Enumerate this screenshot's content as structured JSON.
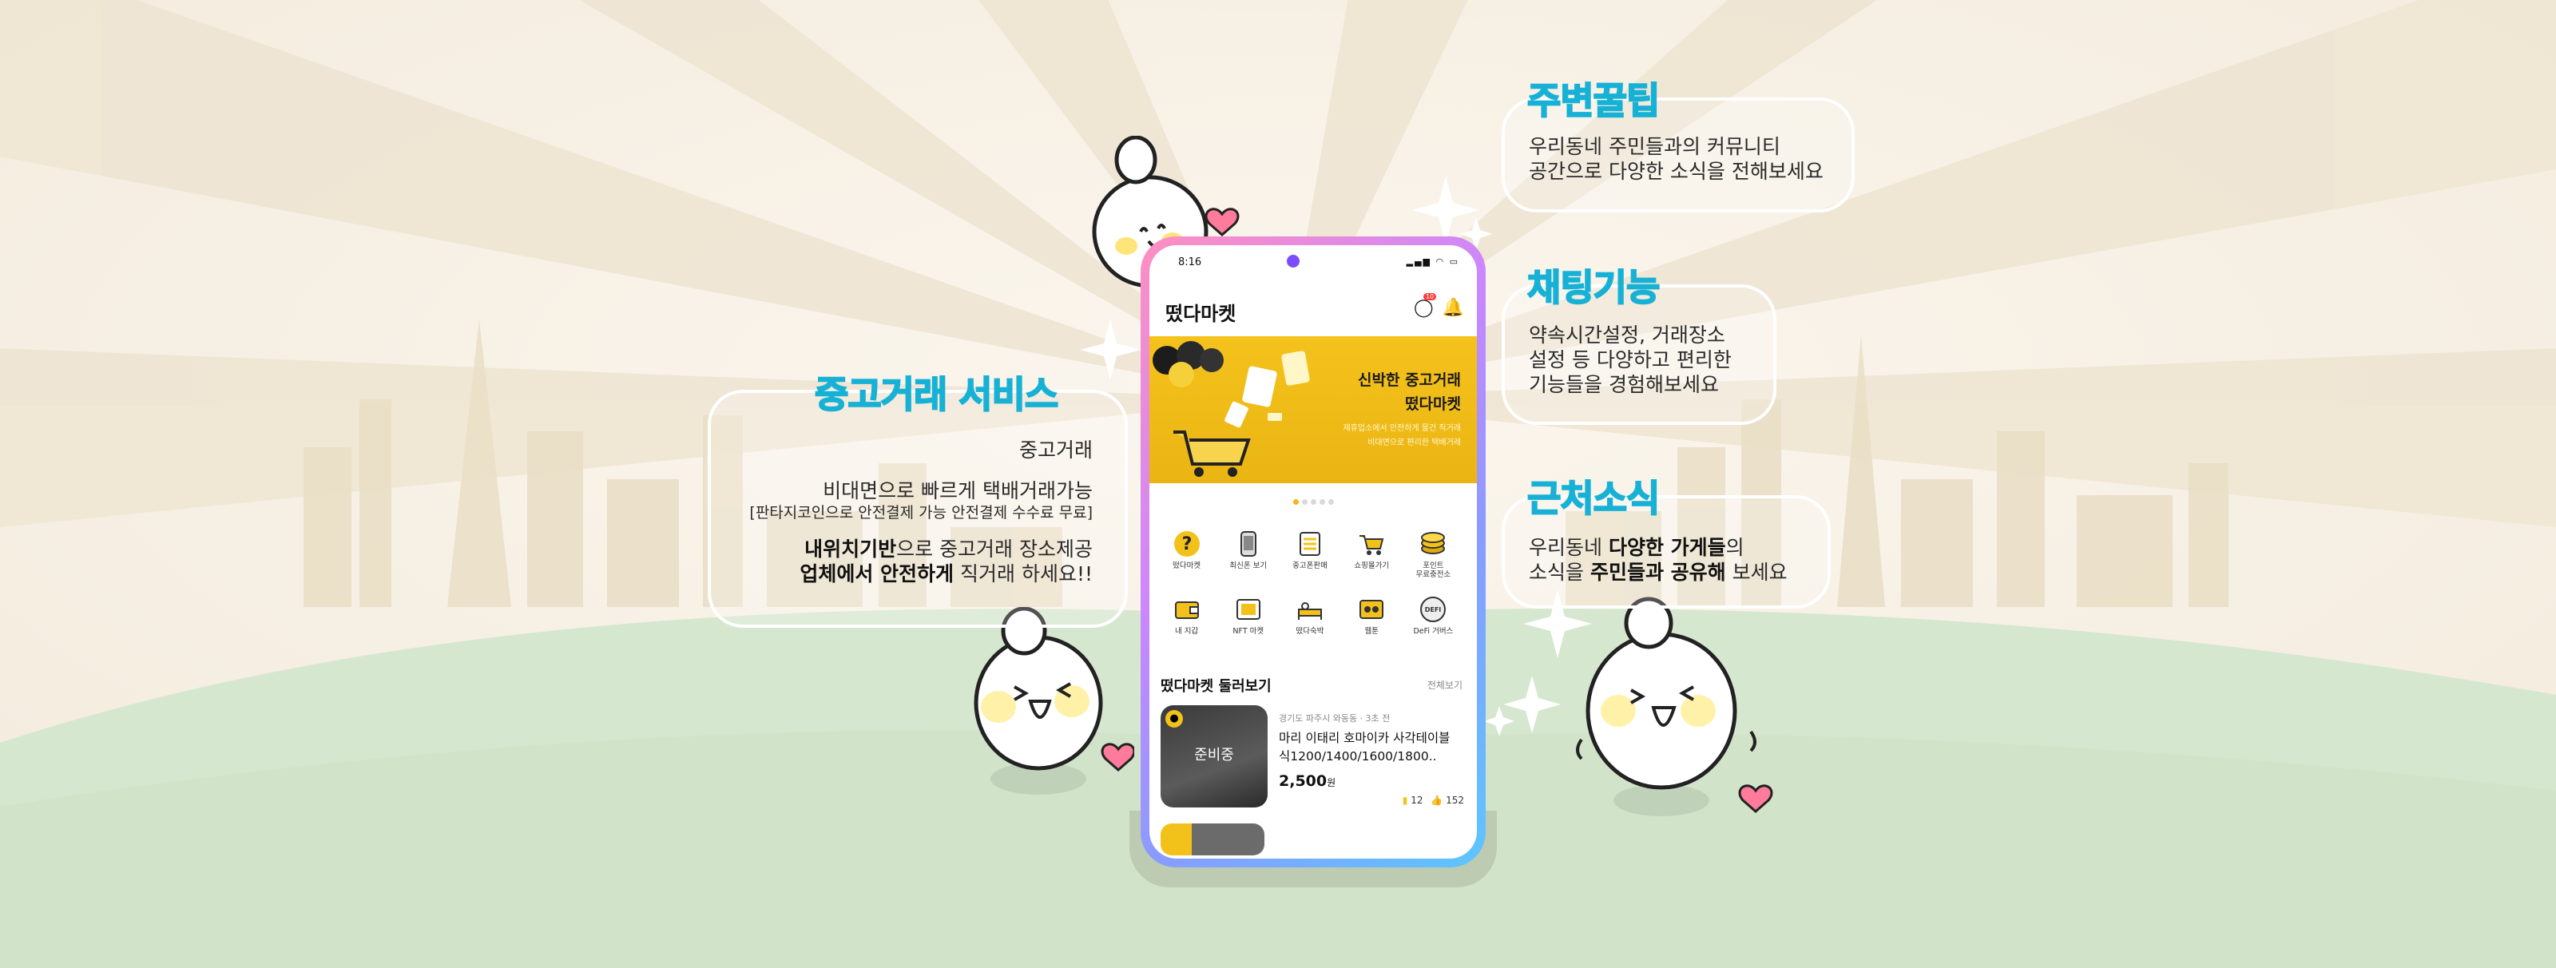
{
  "left": {
    "title": "중고거래 서비스",
    "line1": "중고거래",
    "line2": "비대면으로 빠르게 택배거래가능",
    "line3": "[판타지코인으로 안전결제 가능 안전결제 수수료 무료]",
    "line4_bold": "내위치기반",
    "line4_rest": "으로 중고거래 장소제공",
    "line5_bold": "업체에서 안전하게",
    "line5_rest": " 직거래 하세요!!"
  },
  "right": [
    {
      "title": "주변꿀팁",
      "lines": [
        "우리동네 주민들과의 커뮤니티",
        "공간으로 다양한 소식을 전해보세요"
      ]
    },
    {
      "title": "채팅기능",
      "lines": [
        "약속시간설정, 거래장소",
        "설정 등 다양하고 편리한",
        "기능들을 경험해보세요"
      ]
    },
    {
      "title": "근처소식",
      "line1_pre": "우리동네 ",
      "line1_bold": "다양한 가게들",
      "line1_post": "의",
      "line2_pre": "소식을 ",
      "line2_bold": "주민들과 공유해",
      "line2_post": " 보세요"
    }
  ],
  "phone": {
    "time": "8:16",
    "status_icons": "▂▄▆ ◠ ▭",
    "brand": "떴다마켓",
    "chat_badge": "10",
    "banner": {
      "title1": "신박한 중고거래",
      "title2": "떴다마켓",
      "sub1": "제휴업소에서 안전하게 물건 직거래",
      "sub2": "비대면으로 편리한 택배거래"
    },
    "menu": [
      {
        "label": "떴다마켓",
        "icon": "question-icon"
      },
      {
        "label": "최신폰 보기",
        "icon": "phone-icon"
      },
      {
        "label": "중고폰판매",
        "icon": "checklist-icon"
      },
      {
        "label": "쇼핑몰가기",
        "icon": "cart-icon"
      },
      {
        "label": "포인트\n무료충전소",
        "icon": "coin-icon"
      },
      {
        "label": "내 지갑",
        "icon": "wallet-icon"
      },
      {
        "label": "NFT 마켓",
        "icon": "nft-icon"
      },
      {
        "label": "떴다숙박",
        "icon": "bed-icon"
      },
      {
        "label": "웹툰",
        "icon": "webtoon-icon"
      },
      {
        "label": "DeFi 거버스",
        "icon": "defi-icon"
      }
    ],
    "section_title": "떴다마켓 둘러보기",
    "section_more": "전체보기",
    "item": {
      "thumb_text": "준비중",
      "location": "경기도 파주시 와동동 · 3초 전",
      "title": "마리 이태리 호마이카 사각테이블 식1200/1400/1600/1800..",
      "price": "2,500",
      "price_unit": "원",
      "chats": "12",
      "likes": "152"
    }
  },
  "colors": {
    "accent": "#18b1d6",
    "yellow": "#f3c21a",
    "hill": "#d5e7cf"
  }
}
